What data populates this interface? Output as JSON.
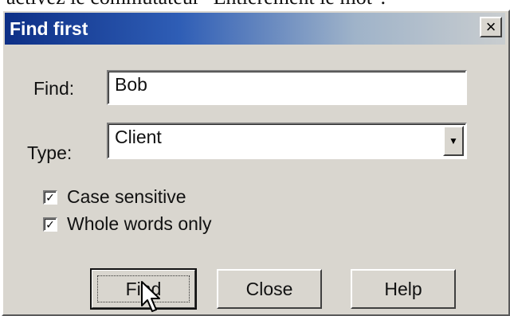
{
  "caption": "activez le commutateur \"Entièrement le mot\".",
  "dialog": {
    "title": "Find first",
    "close_glyph": "×",
    "find_label": "Find:",
    "find_value": "Bob",
    "type_label": "Type:",
    "type_value": "Client",
    "checkboxes": [
      {
        "label": "Case sensitive",
        "checked": true
      },
      {
        "label": "Whole words only",
        "checked": true
      }
    ],
    "buttons": {
      "find": "Find",
      "close": "Close",
      "help": "Help"
    }
  },
  "icons": {
    "close": "close-icon",
    "dropdown": "chevron-down-icon",
    "check": "checkmark-icon",
    "cursor": "mouse-pointer-icon"
  },
  "colors": {
    "title_start": "#0d2f86",
    "title_end": "#c9cdcf",
    "face": "#d9d6cf"
  }
}
